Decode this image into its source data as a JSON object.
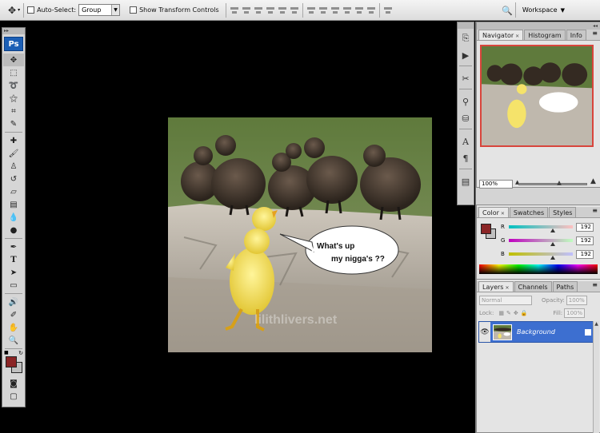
{
  "options_bar": {
    "auto_select_label": "Auto-Select:",
    "auto_select_value": "Group",
    "show_transform_label": "Show Transform Controls",
    "workspace_label": "Workspace"
  },
  "toolbox": {
    "logo": "Ps",
    "foreground_color": "#8b2526",
    "background_color": "#c0c0c0"
  },
  "canvas": {
    "speech_line1": "What's up",
    "speech_line2": "my nigga's ??",
    "watermark": "lilithlivers.net"
  },
  "navigator_panel": {
    "tabs": [
      "Navigator",
      "Histogram",
      "Info"
    ],
    "zoom_value": "100%",
    "zoom_level": 0.6
  },
  "color_panel": {
    "tabs": [
      "Color",
      "Swatches",
      "Styles"
    ],
    "r_label": "R",
    "g_label": "G",
    "b_label": "B",
    "r_value": "192",
    "g_value": "192",
    "b_value": "192"
  },
  "layers_panel": {
    "tabs": [
      "Layers",
      "Channels",
      "Paths"
    ],
    "blend_mode": "Normal",
    "opacity_label": "Opacity:",
    "opacity_value": "100%",
    "lock_label": "Lock:",
    "fill_label": "Fill:",
    "fill_value": "100%",
    "layer_name": "Background"
  }
}
